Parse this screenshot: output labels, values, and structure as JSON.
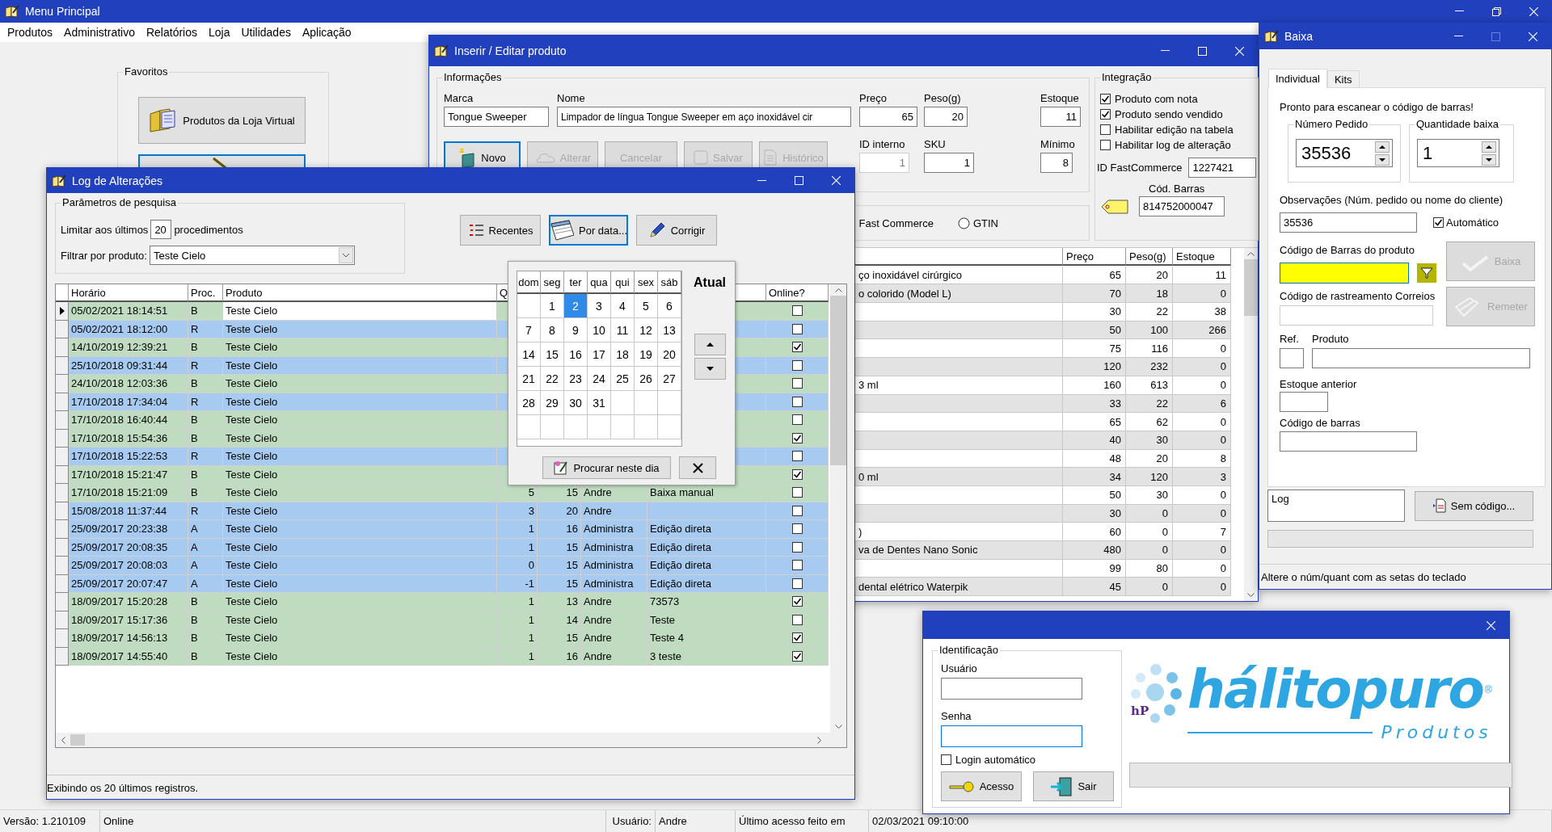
{
  "main_window": {
    "title": "Menu Principal",
    "menu": [
      "Produtos",
      "Administrativo",
      "Relatórios",
      "Loja",
      "Utilidades",
      "Aplicação"
    ],
    "favorites": {
      "title": "Favoritos",
      "buttons": [
        {
          "kind": "labeled",
          "label": "Produtos da Loja Virtual"
        },
        {
          "kind": "icon_only"
        }
      ]
    },
    "status_bar": [
      "Versão: 1.210109",
      "Online",
      "Usuário:",
      "Andre",
      "Último acesso feito em",
      "02/03/2021 09:10:00"
    ]
  },
  "product_window": {
    "title": "Inserir / Editar produto",
    "informacoes": {
      "title": "Informações",
      "marca": {
        "label": "Marca",
        "value": "Tongue Sweeper"
      },
      "nome": {
        "label": "Nome",
        "value": "Limpador de língua Tongue Sweeper em aço inoxidável cir"
      },
      "preco": {
        "label": "Preço",
        "value": "65"
      },
      "peso": {
        "label": "Peso(g)",
        "value": "20"
      },
      "estoque": {
        "label": "Estoque",
        "value": "11"
      },
      "id_interno": {
        "label": "ID interno",
        "value": "1",
        "disabled": true
      },
      "sku": {
        "label": "SKU",
        "value": "1",
        "disabled": false
      },
      "minimo": {
        "label": "Mínimo",
        "value": "8"
      },
      "buttons": [
        {
          "label": "Novo",
          "disabled": false,
          "selected": true
        },
        {
          "label": "Alterar",
          "disabled": true,
          "selected": false
        },
        {
          "label": "Cancelar",
          "disabled": true,
          "selected": false
        },
        {
          "label": "Salvar",
          "disabled": true,
          "selected": false
        },
        {
          "label": "Histórico",
          "disabled": true,
          "selected": false
        }
      ]
    },
    "integracao": {
      "title": "Integração",
      "checks": [
        {
          "label": "Produto com nota",
          "checked": true
        },
        {
          "label": "Produto sendo vendido",
          "checked": true
        },
        {
          "label": "Habilitar edição na tabela",
          "checked": false
        },
        {
          "label": "Habilitar log de alteração",
          "checked": false
        }
      ],
      "id_fastcommerce": {
        "label": "ID FastCommerce",
        "value": "1227421"
      },
      "cod_barras": {
        "label": "Cód. Barras",
        "value": "814752000047"
      }
    },
    "source": {
      "caption": "Fast Commerce",
      "gtin": {
        "label": "GTIN",
        "selected": false
      }
    },
    "table": {
      "columns": [
        "Preço",
        "Peso(g)",
        "Estoque"
      ],
      "rows": [
        {
          "name": "ço inoxidável cirúrgico",
          "values": [
            "65",
            "20",
            "11"
          ]
        },
        {
          "name": "o colorido (Model L)",
          "values": [
            "70",
            "18",
            "0"
          ]
        },
        {
          "values": [
            "30",
            "22",
            "38"
          ]
        },
        {
          "values": [
            "50",
            "100",
            "266"
          ]
        },
        {
          "values": [
            "75",
            "116",
            "0"
          ]
        },
        {
          "values": [
            "120",
            "232",
            "0"
          ]
        },
        {
          "name": "3 ml",
          "values": [
            "160",
            "613",
            "0"
          ]
        },
        {
          "values": [
            "33",
            "22",
            "6"
          ]
        },
        {
          "values": [
            "65",
            "62",
            "0"
          ]
        },
        {
          "values": [
            "40",
            "30",
            "0"
          ]
        },
        {
          "values": [
            "48",
            "20",
            "8"
          ]
        },
        {
          "name": "0 ml",
          "values": [
            "34",
            "120",
            "3"
          ]
        },
        {
          "values": [
            "50",
            "30",
            "0"
          ]
        },
        {
          "values": [
            "30",
            "0",
            "0"
          ]
        },
        {
          "name": ")",
          "values": [
            "60",
            "0",
            "7"
          ]
        },
        {
          "name": "va de Dentes Nano Sonic",
          "values": [
            "480",
            "0",
            "0"
          ]
        },
        {
          "values": [
            "99",
            "80",
            "0"
          ]
        },
        {
          "name": "dental elétrico Waterpik",
          "values": [
            "45",
            "0",
            "0"
          ]
        }
      ]
    }
  },
  "log_window": {
    "title": "Log de Alterações",
    "params": {
      "title": "Parâmetros de pesquisa",
      "limit_label": "Limitar aos últimos",
      "limit_value": "20",
      "limit_suffix": "procedimentos",
      "filter_label": "Filtrar por produto:",
      "filter_value": "Teste Cielo"
    },
    "buttons": [
      {
        "label": "Recentes",
        "selected": false
      },
      {
        "label": "Por data...",
        "selected": true
      },
      {
        "label": "Corrigir",
        "selected": false
      }
    ],
    "table": {
      "columns": [
        "Horário",
        "Proc.",
        "Produto",
        "Q",
        "Online?"
      ],
      "rows": [
        {
          "time": "05/02/2021 18:14:51",
          "proc": "B",
          "product": "Teste Cielo",
          "online": false,
          "selected": true,
          "color": "#c0dcc0"
        },
        {
          "time": "05/02/2021 18:12:00",
          "proc": "R",
          "product": "Teste Cielo",
          "online": false,
          "selected": false,
          "color": "#a6caf0"
        },
        {
          "time": "14/10/2019 12:39:21",
          "proc": "B",
          "product": "Teste Cielo",
          "online": true,
          "selected": false,
          "color": "#c0dcc0"
        },
        {
          "time": "25/10/2018 09:31:44",
          "proc": "R",
          "product": "Teste Cielo",
          "online": false,
          "selected": false,
          "color": "#a6caf0"
        },
        {
          "time": "24/10/2018 12:03:36",
          "proc": "B",
          "product": "Teste Cielo",
          "online": false,
          "selected": false,
          "color": "#c0dcc0"
        },
        {
          "time": "17/10/2018 17:34:04",
          "proc": "R",
          "product": "Teste Cielo",
          "online": false,
          "selected": false,
          "color": "#a6caf0"
        },
        {
          "time": "17/10/2018 16:40:44",
          "proc": "B",
          "product": "Teste Cielo",
          "online": false,
          "selected": false,
          "color": "#c0dcc0"
        },
        {
          "time": "17/10/2018 15:54:36",
          "proc": "B",
          "product": "Teste Cielo",
          "online": true,
          "selected": false,
          "color": "#c0dcc0"
        },
        {
          "time": "17/10/2018 15:22:53",
          "proc": "R",
          "product": "Teste Cielo",
          "online": false,
          "selected": false,
          "color": "#a6caf0"
        },
        {
          "time": "17/10/2018 15:21:47",
          "proc": "B",
          "product": "Teste Cielo",
          "online": true,
          "selected": false,
          "color": "#c0dcc0"
        },
        {
          "time": "17/10/2018 15:21:09",
          "proc": "B",
          "product": "Teste Cielo",
          "qty": "5",
          "stock": "15",
          "user": "Andre",
          "note": "Baixa manual",
          "online": false,
          "selected": false,
          "color": "#c0dcc0"
        },
        {
          "time": "15/08/2018 11:37:44",
          "proc": "R",
          "product": "Teste Cielo",
          "qty": "3",
          "stock": "20",
          "user": "Andre",
          "online": false,
          "selected": false,
          "color": "#a6caf0"
        },
        {
          "time": "25/09/2017 20:23:38",
          "proc": "A",
          "product": "Teste Cielo",
          "qty": "1",
          "stock": "16",
          "user": "Administra",
          "note": "Edição direta",
          "online": false,
          "selected": false,
          "color": "#a6caf0"
        },
        {
          "time": "25/09/2017 20:08:35",
          "proc": "A",
          "product": "Teste Cielo",
          "qty": "1",
          "stock": "15",
          "user": "Administra",
          "note": "Edição direta",
          "online": false,
          "selected": false,
          "color": "#a6caf0"
        },
        {
          "time": "25/09/2017 20:08:03",
          "proc": "A",
          "product": "Teste Cielo",
          "qty": "0",
          "stock": "15",
          "user": "Administra",
          "note": "Edição direta",
          "online": false,
          "selected": false,
          "color": "#a6caf0"
        },
        {
          "time": "25/09/2017 20:07:47",
          "proc": "A",
          "product": "Teste Cielo",
          "qty": "-1",
          "stock": "15",
          "user": "Administra",
          "note": "Edição direta",
          "online": false,
          "selected": false,
          "color": "#a6caf0"
        },
        {
          "time": "18/09/2017 15:20:28",
          "proc": "B",
          "product": "Teste Cielo",
          "qty": "1",
          "stock": "13",
          "user": "Andre",
          "note": "73573",
          "online": true,
          "selected": false,
          "color": "#c0dcc0"
        },
        {
          "time": "18/09/2017 15:17:36",
          "proc": "B",
          "product": "Teste Cielo",
          "qty": "1",
          "stock": "14",
          "user": "Andre",
          "note": "Teste",
          "online": false,
          "selected": false,
          "color": "#c0dcc0"
        },
        {
          "time": "18/09/2017 14:56:13",
          "proc": "B",
          "product": "Teste Cielo",
          "qty": "1",
          "stock": "15",
          "user": "Andre",
          "note": "Teste 4",
          "online": true,
          "selected": false,
          "color": "#c0dcc0"
        },
        {
          "time": "18/09/2017 14:55:40",
          "proc": "B",
          "product": "Teste Cielo",
          "qty": "1",
          "stock": "16",
          "user": "Andre",
          "note": "3 teste",
          "online": true,
          "selected": false,
          "color": "#c0dcc0"
        }
      ]
    },
    "status": "Exibindo os 20 últimos registros.",
    "calendar": {
      "weekdays": [
        "dom",
        "seg",
        "ter",
        "qua",
        "qui",
        "sex",
        "sáb"
      ],
      "days": [
        {
          "day": "1",
          "selected": false
        },
        {
          "day": "2",
          "selected": true
        },
        {
          "day": "3",
          "selected": false
        },
        {
          "day": "4",
          "selected": false
        },
        {
          "day": "5",
          "selected": false
        },
        {
          "day": "6",
          "selected": false
        },
        {
          "day": "7",
          "selected": false
        },
        {
          "day": "8",
          "selected": false
        },
        {
          "day": "9",
          "selected": false
        },
        {
          "day": "10",
          "selected": false
        },
        {
          "day": "11",
          "selected": false
        },
        {
          "day": "12",
          "selected": false
        },
        {
          "day": "13",
          "selected": false
        },
        {
          "day": "14",
          "selected": false
        },
        {
          "day": "15",
          "selected": false
        },
        {
          "day": "16",
          "selected": false
        },
        {
          "day": "17",
          "selected": false
        },
        {
          "day": "18",
          "selected": false
        },
        {
          "day": "19",
          "selected": false
        },
        {
          "day": "20",
          "selected": false
        },
        {
          "day": "21",
          "selected": false
        },
        {
          "day": "22",
          "selected": false
        },
        {
          "day": "23",
          "selected": false
        },
        {
          "day": "24",
          "selected": false
        },
        {
          "day": "25",
          "selected": false
        },
        {
          "day": "26",
          "selected": false
        },
        {
          "day": "27",
          "selected": false
        },
        {
          "day": "28",
          "selected": false
        },
        {
          "day": "29",
          "selected": false
        },
        {
          "day": "30",
          "selected": false
        },
        {
          "day": "31",
          "selected": false
        }
      ],
      "today_label": "Atual",
      "search_button": "Procurar neste dia"
    }
  },
  "baixa_window": {
    "title": "Baixa",
    "tabs": [
      {
        "label": "Individual",
        "selected": true
      },
      {
        "label": "Kits",
        "selected": false
      }
    ],
    "ready_text": "Pronto para escanear o código de barras!",
    "pedido": {
      "label": "Número Pedido",
      "value": "35536"
    },
    "quantidade": {
      "label": "Quantidade baixa",
      "value": "1"
    },
    "obs": {
      "label": "Observações (Núm. pedido ou nome do cliente)",
      "value": "35536"
    },
    "automatico": {
      "label": "Automático",
      "checked": true
    },
    "barcode_label": "Código de Barras do produto",
    "baixa_button": {
      "label": "Baixa",
      "disabled": true
    },
    "rastreio_label": "Código de rastreamento Correios",
    "remeter_button": {
      "label": "Remeter",
      "disabled": true
    },
    "ref_label": "Ref.",
    "produto_label": "Produto",
    "estoque_label": "Estoque anterior",
    "codigo_label": "Código de barras",
    "log_value": "Log",
    "sem_codigo_button": "Sem código...",
    "progress": {
      "level": 0
    },
    "hint": "Altere o núm/quant com as setas do teclado"
  },
  "login_window": {
    "group": "Identificação",
    "usuario_label": "Usuário",
    "senha_label": "Senha",
    "auto_login": {
      "label": "Login automático",
      "checked": false
    },
    "buttons": [
      "Acesso",
      "Sair"
    ],
    "progress": {
      "level": 0
    },
    "logo": {
      "mark": "hP",
      "name": "hálitopuro",
      "registered": "®",
      "tagline": "Produtos"
    }
  }
}
